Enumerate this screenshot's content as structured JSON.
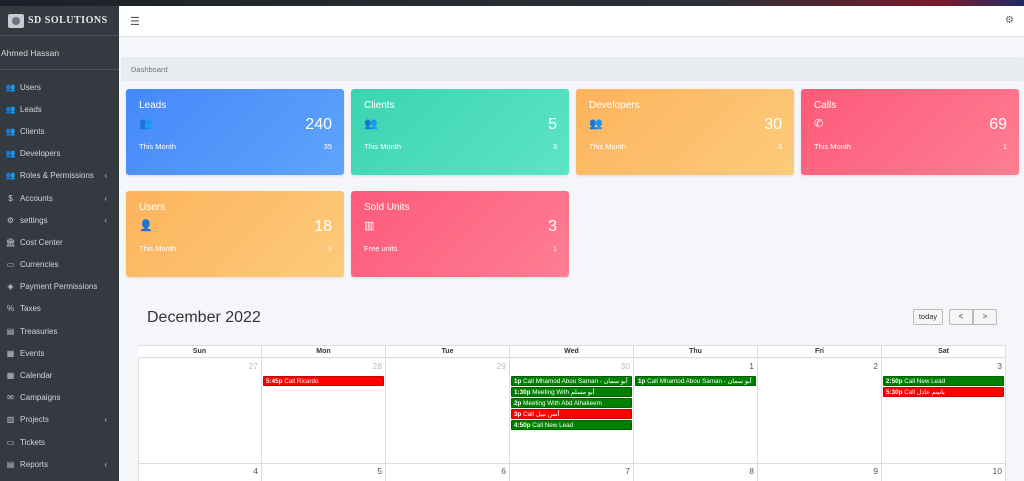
{
  "brand": {
    "name": "SD SOLUTIONS"
  },
  "user": {
    "name": "Ahmed Hassan"
  },
  "sidebar": {
    "items": [
      {
        "label": "Users",
        "icon": "users-icon",
        "arrow": false
      },
      {
        "label": "Leads",
        "icon": "users-icon",
        "arrow": false
      },
      {
        "label": "Clients",
        "icon": "users-icon",
        "arrow": false
      },
      {
        "label": "Developers",
        "icon": "users-icon",
        "arrow": false
      },
      {
        "label": "Roles & Permissions",
        "icon": "users-icon",
        "arrow": true
      },
      {
        "label": "Accounts",
        "icon": "dollar-icon",
        "arrow": true
      },
      {
        "label": "settings",
        "icon": "gear-icon",
        "arrow": true
      },
      {
        "label": "Cost Center",
        "icon": "bank-icon",
        "arrow": false
      },
      {
        "label": "Currencies",
        "icon": "money-icon",
        "arrow": false
      },
      {
        "label": "Payment Permissions",
        "icon": "tag-icon",
        "arrow": false
      },
      {
        "label": "Taxes",
        "icon": "percent-icon",
        "arrow": false
      },
      {
        "label": "Treasuries",
        "icon": "table-icon",
        "arrow": false
      },
      {
        "label": "Events",
        "icon": "calendar-icon",
        "arrow": false
      },
      {
        "label": "Calendar",
        "icon": "calendar-icon",
        "arrow": false
      },
      {
        "label": "Campaigns",
        "icon": "envelope-icon",
        "arrow": false
      },
      {
        "label": "Projects",
        "icon": "building-icon",
        "arrow": true
      },
      {
        "label": "Tickets",
        "icon": "ticket-icon",
        "arrow": false
      },
      {
        "label": "Reports",
        "icon": "report-icon",
        "arrow": true
      }
    ]
  },
  "breadcrumb": {
    "current": "Dashboard"
  },
  "cards": [
    {
      "title": "Leads",
      "value": "240",
      "sub_label": "This Month",
      "sub_value": "35",
      "icon": "users-icon",
      "color": "#4489fa"
    },
    {
      "title": "Clients",
      "value": "5",
      "sub_label": "This Month",
      "sub_value": "3",
      "icon": "users-icon",
      "color": "#3bd4b0"
    },
    {
      "title": "Developers",
      "value": "30",
      "sub_label": "This Month",
      "sub_value": "3",
      "icon": "users-icon",
      "color": "#fdb35c"
    },
    {
      "title": "Calls",
      "value": "69",
      "sub_label": "This Month",
      "sub_value": "1",
      "icon": "phone-icon",
      "color": "#fd5a7a"
    },
    {
      "title": "Users",
      "value": "18",
      "sub_label": "This Month",
      "sub_value": "3",
      "icon": "user-plus-icon",
      "color": "#fdb35c"
    },
    {
      "title": "Sold Units",
      "value": "3",
      "sub_label": "Free units",
      "sub_value": "1",
      "icon": "building-icon",
      "color": "#fd5a7a"
    }
  ],
  "calendar": {
    "title": "December 2022",
    "today_label": "today",
    "prev_label": "<",
    "next_label": ">",
    "weekdays": [
      "Sun",
      "Mon",
      "Tue",
      "Wed",
      "Thu",
      "Fri",
      "Sat"
    ],
    "weeks": [
      {
        "days": [
          {
            "num": "27",
            "other": true,
            "events": []
          },
          {
            "num": "28",
            "other": true,
            "events": [
              {
                "time": "5:45p",
                "title": "Call Ricardo",
                "color": "red"
              }
            ]
          },
          {
            "num": "29",
            "other": true,
            "events": []
          },
          {
            "num": "30",
            "other": true,
            "events": [
              {
                "time": "1p",
                "title": "Call Mhamod Abou Saman - أبو سمان",
                "color": "green"
              },
              {
                "time": "1:30p",
                "title": "Meeting With أبو مسلم",
                "color": "green"
              },
              {
                "time": "2p",
                "title": "Meeting With Abd Alhakeem",
                "color": "green"
              },
              {
                "time": "3p",
                "title": "Call أنس نبيل",
                "color": "red"
              },
              {
                "time": "4:50p",
                "title": "Call New Lead",
                "color": "green"
              }
            ]
          },
          {
            "num": "1",
            "other": false,
            "events": [
              {
                "time": "1p",
                "title": "Call Mhamod Abou Saman - أبو سمان",
                "color": "green"
              }
            ]
          },
          {
            "num": "2",
            "other": false,
            "events": []
          },
          {
            "num": "3",
            "other": false,
            "events": [
              {
                "time": "2:50p",
                "title": "Call New Lead",
                "color": "green"
              },
              {
                "time": "5:30p",
                "title": "Call باسم عادل",
                "color": "red"
              }
            ]
          }
        ]
      },
      {
        "days": [
          {
            "num": "4",
            "other": false,
            "events": []
          },
          {
            "num": "5",
            "other": false,
            "events": []
          },
          {
            "num": "6",
            "other": false,
            "events": []
          },
          {
            "num": "7",
            "other": false,
            "events": []
          },
          {
            "num": "8",
            "other": false,
            "events": []
          },
          {
            "num": "9",
            "other": false,
            "events": []
          },
          {
            "num": "10",
            "other": false,
            "events": []
          }
        ]
      }
    ]
  }
}
